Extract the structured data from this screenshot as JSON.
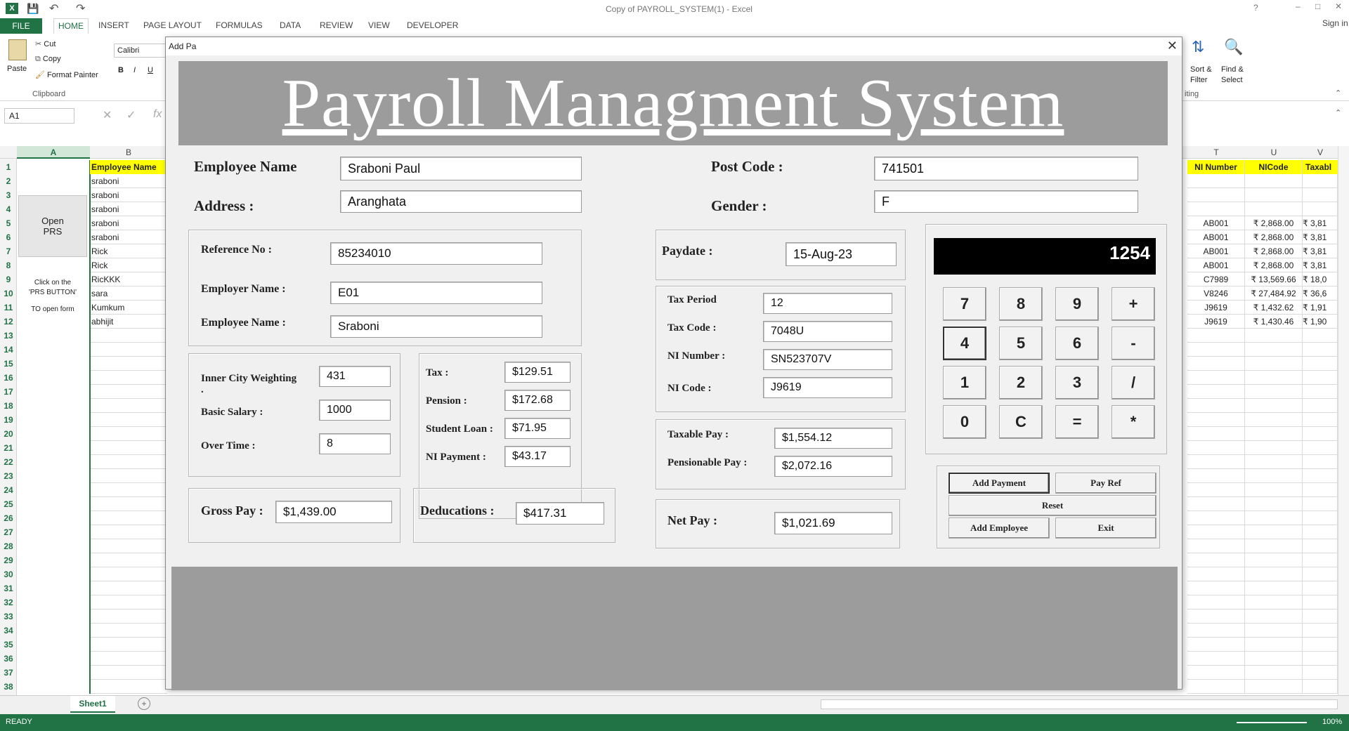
{
  "window": {
    "title": "Copy of PAYROLL_SYSTEM(1) - Excel",
    "signin": "Sign in"
  },
  "ribbon": {
    "tabs": [
      "FILE",
      "HOME",
      "INSERT",
      "PAGE LAYOUT",
      "FORMULAS",
      "DATA",
      "REVIEW",
      "VIEW",
      "DEVELOPER"
    ],
    "paste": "Paste",
    "cut": "Cut",
    "copy": "Copy",
    "format_painter": "Format Painter",
    "clipboard": "Clipboard",
    "font_name": "Calibri",
    "sort_filter": "Sort &",
    "sort_filter2": "Filter",
    "find_select": "Find &",
    "find_select2": "Select",
    "editing": "iting"
  },
  "formula_bar": {
    "name_box": "A1"
  },
  "sheet": {
    "col_a": "A",
    "col_b": "B",
    "col_t": "T",
    "col_u": "U",
    "col_v": "V",
    "header_b": "Employee Name",
    "header_t": "NI Number",
    "header_u": "NICode",
    "header_v": "Taxabl",
    "open_prs": "Open\nPRS",
    "note1": "Click on the",
    "note2": "'PRS BUTTON'",
    "note3": "TO open form",
    "names": [
      "sraboni",
      "sraboni",
      "sraboni",
      "sraboni",
      "sraboni",
      "Rick",
      "Rick",
      "RicKKK",
      "sara",
      "Kumkum",
      "abhijit"
    ],
    "right_rows": [
      {
        "row": 5,
        "t": "AB001",
        "u": "₹ 2,868.00",
        "v": "₹ 3,81"
      },
      {
        "row": 6,
        "t": "AB001",
        "u": "₹ 2,868.00",
        "v": "₹ 3,81"
      },
      {
        "row": 7,
        "t": "AB001",
        "u": "₹ 2,868.00",
        "v": "₹ 3,81"
      },
      {
        "row": 8,
        "t": "AB001",
        "u": "₹ 2,868.00",
        "v": "₹ 3,81"
      },
      {
        "row": 9,
        "t": "C7989",
        "u": "₹ 13,569.66",
        "v": "₹ 18,0"
      },
      {
        "row": 10,
        "t": "V8246",
        "u": "₹ 27,484.92",
        "v": "₹ 36,6"
      },
      {
        "row": 11,
        "t": "J9619",
        "u": "₹ 1,432.62",
        "v": "₹ 1,91"
      },
      {
        "row": 12,
        "t": "J9619",
        "u": "₹ 1,430.46",
        "v": "₹ 1,90"
      }
    ],
    "tab": "Sheet1"
  },
  "status": {
    "ready": "READY",
    "zoom": "100%"
  },
  "dialog": {
    "title": "Add Pa",
    "banner": "Payroll Managment System",
    "labels": {
      "employee_name": "Employee Name",
      "address": "Address :",
      "post_code": "Post Code :",
      "gender": "Gender :",
      "reference_no": "Reference No :",
      "employer_name": "Employer Name :",
      "employee_name2": "Employee  Name :",
      "paydate": "Paydate :",
      "tax_period": "Tax Period",
      "tax_code": "Tax Code :",
      "ni_number": "NI Number :",
      "ni_code": "NI Code :",
      "inner_city": "Inner City Weighting",
      "inner_city_dot": ".",
      "basic_salary": "Basic Salary :",
      "over_time": "Over Time :",
      "tax": "Tax :",
      "pension": "Pension :",
      "student_loan": "Student Loan :",
      "ni_payment": "NI Payment :",
      "taxable_pay": "Taxable Pay :",
      "pensionable_pay": "Pensionable  Pay :",
      "gross_pay": "Gross Pay :",
      "deductions": "Deducations :",
      "net_pay": "Net Pay :"
    },
    "values": {
      "employee_name": "Sraboni Paul",
      "address": "Aranghata",
      "post_code": "741501",
      "gender": "F",
      "reference_no": "85234010",
      "employer_name": "E01",
      "employee_name2": "Sraboni",
      "paydate": "15-Aug-23",
      "tax_period": "12",
      "tax_code": "7048U",
      "ni_number": "SN523707V",
      "ni_code": "J9619",
      "inner_city": "431",
      "basic_salary": "1000",
      "over_time": "8",
      "tax": "$129.51",
      "pension": "$172.68",
      "student_loan": "$71.95",
      "ni_payment": "$43.17",
      "taxable_pay": "$1,554.12",
      "pensionable_pay": "$2,072.16",
      "gross_pay": "$1,439.00",
      "deductions": "$417.31",
      "net_pay": "$1,021.69"
    },
    "calculator": {
      "display": "1254",
      "keys": [
        "7",
        "8",
        "9",
        "+",
        "4",
        "5",
        "6",
        "-",
        "1",
        "2",
        "3",
        "/",
        "0",
        "C",
        "=",
        "*"
      ]
    },
    "buttons": {
      "add_payment": "Add Payment",
      "pay_ref": "Pay Ref",
      "reset": "Reset",
      "add_employee": "Add Employee",
      "exit": "Exit"
    }
  }
}
